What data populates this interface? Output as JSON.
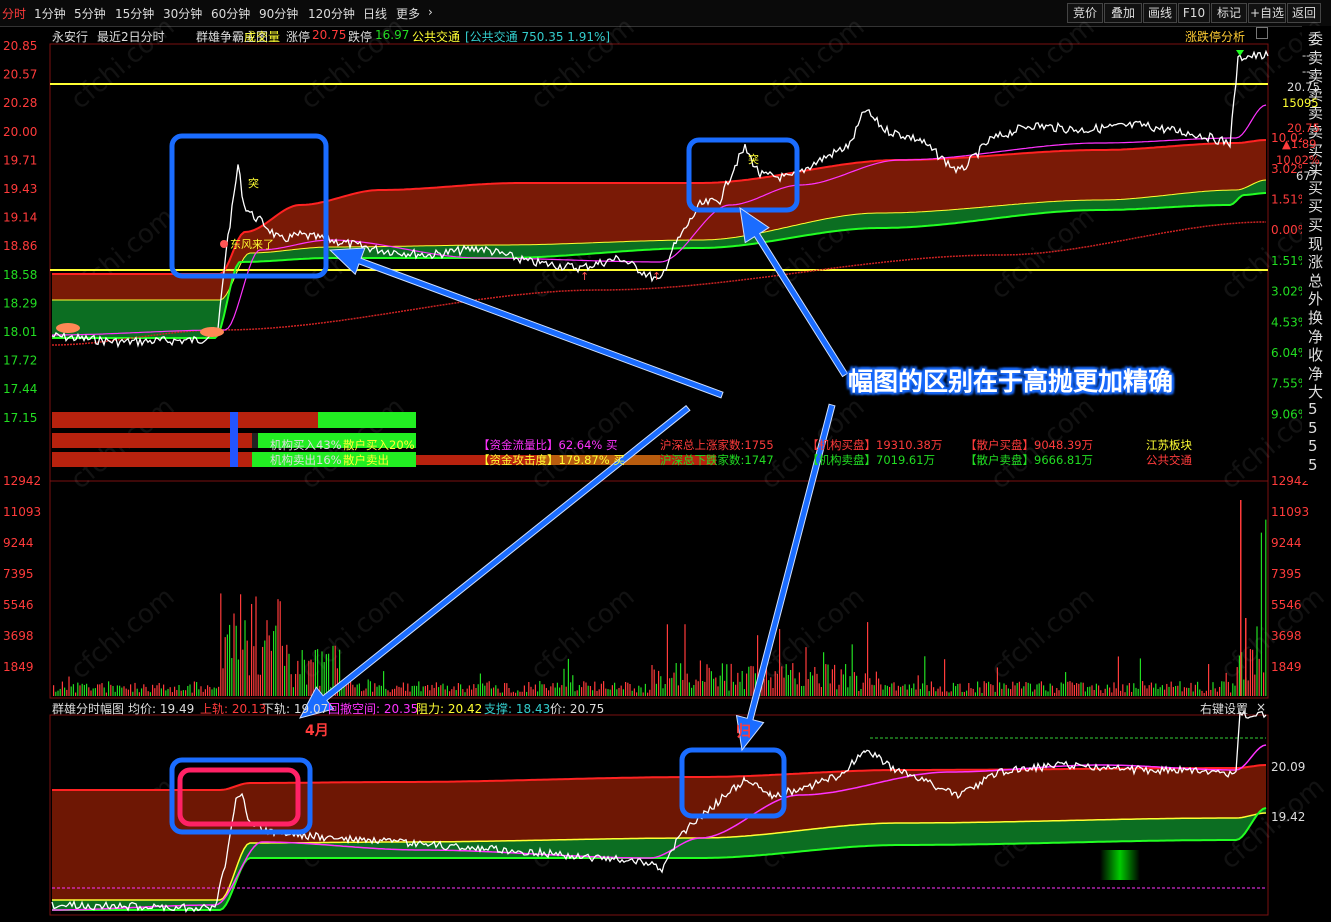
{
  "timeframes": [
    {
      "label": "分时",
      "active": true
    },
    {
      "label": "1分钟",
      "active": false
    },
    {
      "label": "5分钟",
      "active": false
    },
    {
      "label": "15分钟",
      "active": false
    },
    {
      "label": "30分钟",
      "active": false
    },
    {
      "label": "60分钟",
      "active": false
    },
    {
      "label": "90分钟",
      "active": false
    },
    {
      "label": "120分钟",
      "active": false
    },
    {
      "label": "日线",
      "active": false
    },
    {
      "label": "更多",
      "active": false
    }
  ],
  "toolbar": {
    "bid_label": "竞价",
    "overlay_label": "叠加",
    "draw_label": "画线",
    "f10_label": "F10",
    "mark_label": "标记",
    "watch_label": "+自选",
    "back_label": "返回"
  },
  "info": {
    "stock_name": "永安行",
    "view_mode": "最近2日分时",
    "indicator": "群雄争霸主图",
    "volume_label": "成交量",
    "limit_up_label": "涨停",
    "limit_up_value": "20.75",
    "limit_down_label": "跌停",
    "limit_down_value": "16.97",
    "sector": "公共交通",
    "sector_quote": "[公共交通 750.35 1.91%]",
    "analysis_button": "涨跌停分析"
  },
  "side_strip": [
    "委",
    "卖",
    "卖",
    "卖",
    "卖",
    "卖",
    "买",
    "买",
    "买",
    "买",
    "买",
    "现",
    "涨",
    "总",
    "外",
    "换",
    "净",
    "收",
    "净",
    "大",
    "5",
    "5",
    "5",
    "5"
  ],
  "price_axis_left": [
    "20.85",
    "20.57",
    "20.28",
    "20.00",
    "19.71",
    "19.43",
    "19.14",
    "18.86",
    "18.58",
    "18.29",
    "18.01",
    "17.72",
    "17.44",
    "17.15"
  ],
  "pct_axis_right": [
    "",
    "",
    "",
    "10.02%",
    "3.02%",
    "1.51%",
    "0.00%",
    "1.51%",
    "3.02%",
    "4.53%",
    "6.04%",
    "7.55%",
    "9.06%"
  ],
  "quote_right": {
    "dash1": "--",
    "dash2": "--",
    "price": "20.75",
    "vol": "15095",
    "price2": "20.75",
    "change": "▲1.89",
    "change_pct": "10.02%",
    "other": "677"
  },
  "volume_axis": [
    "12942",
    "11093",
    "9244",
    "7395",
    "5546",
    "3698",
    "1849"
  ],
  "lower_axis": [
    "20.09",
    "19.42"
  ],
  "panel_labels": {
    "breakout1": "突",
    "breakout2": "突",
    "dongfeng": "东风来了",
    "inst_buy": "机构买入43%",
    "retail_buy": "散户买入20%",
    "inst_sell": "机构卖出16%",
    "retail_sell": "散户卖出"
  },
  "stats": {
    "flow_ratio": "【资金流量比】62.64% 买",
    "attack": "【资金攻击度】179.87% 买",
    "up_count": "沪深总上涨家数:1755",
    "down_count": "沪深总下跌家数:1747",
    "inst_buy": "【机构买盘】19310.38万",
    "inst_sell": "【机构卖盘】7019.61万",
    "retail_buy": "【散户买盘】9048.39万",
    "retail_sell": "【散户卖盘】9666.81万",
    "sector1": "江苏板块",
    "sector2": "公共交通"
  },
  "bottom": {
    "title": "群雄分时幅图",
    "avg": "均价: 19.49",
    "upper": "上轨: 20.13",
    "lower": "下轨: 19.07",
    "mid_space": "回撤空间: 20.35",
    "resistance": "阻力: 20.42",
    "support": "支撑: 18.43",
    "price": "价: 20.75",
    "settings": "右键设置",
    "tag_left": "4月",
    "tag_right": "归"
  },
  "annotation": "幅图的区别在于高抛更加精确",
  "watermark": "cfchi.com",
  "colors": {
    "up": "#ff3b3b",
    "down": "#22dd22",
    "yellow": "#ffff33",
    "magenta": "#ff33ff",
    "cyan": "#33cccc",
    "accent_blue": "#1a6cff"
  }
}
